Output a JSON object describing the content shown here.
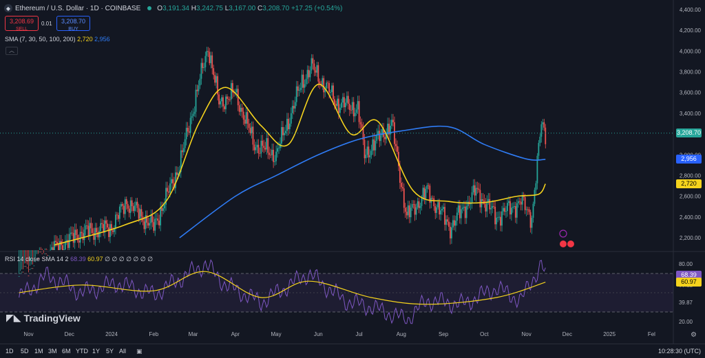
{
  "header": {
    "symbol_icon": "ethereum-icon",
    "title": "Ethereum / U.S. Dollar · 1D · COINBASE",
    "open_label": "O",
    "open": "3,191.34",
    "high_label": "H",
    "high": "3,242.75",
    "low_label": "L",
    "low": "3,167.00",
    "close_label": "C",
    "close": "3,208.70",
    "change": "+17.25 (+0.54%)"
  },
  "trade": {
    "sell_price": "3,208.69",
    "sell_label": "SELL",
    "spread": "0.01",
    "buy_price": "3,208.70",
    "buy_label": "BUY"
  },
  "sma_legend": {
    "label": "SMA (7, 30, 50, 100, 200)",
    "value_yellow": "2,720",
    "value_blue": "2,956"
  },
  "rsi_legend": {
    "label": "RSI 14 close SMA 14 2",
    "value_rsi": "68.39",
    "value_sma": "60.97",
    "blanks": "∅ ∅ ∅ ∅ ∅ ∅ ∅"
  },
  "price_axis": [
    "4,400.00",
    "4,200.00",
    "4,000.00",
    "3,800.00",
    "3,600.00",
    "3,400.00",
    "3,000.00",
    "2,800.00",
    "2,600.00",
    "2,400.00",
    "2,200.00"
  ],
  "price_tags": {
    "last": "3,208.70",
    "sma_blue": "2,956",
    "sma_yellow": "2,720"
  },
  "rsi_axis": [
    "80.00",
    "58.12",
    "39.87",
    "20.00"
  ],
  "rsi_tags": {
    "rsi": "68.39",
    "sma": "60.97"
  },
  "time_axis": [
    "Nov",
    "Dec",
    "2024",
    "Feb",
    "Mar",
    "Apr",
    "May",
    "Jun",
    "Jul",
    "Aug",
    "Sep",
    "Oct",
    "Nov",
    "Dec",
    "2025",
    "Fel"
  ],
  "bottom_bar": {
    "timeframes": [
      "1D",
      "5D",
      "1M",
      "3M",
      "6M",
      "YTD",
      "1Y",
      "5Y",
      "All"
    ],
    "clock": "10:28:30 (UTC)"
  },
  "branding": "TradingView",
  "colors": {
    "up": "#26a69a",
    "down": "#ef5350",
    "sma_yellow": "#f5d31d",
    "sma_blue": "#2f7cf6",
    "rsi_line": "#7e57c2",
    "background": "#131722"
  },
  "chart_data": [
    {
      "type": "candlestick",
      "title": "Ethereum / U.S. Dollar · 1D · COINBASE",
      "ylim": [
        2100,
        4450
      ],
      "x_range": [
        "Oct 2023",
        "Feb 2025"
      ],
      "series": [
        {
          "name": "ETHUSD close (approx.)",
          "x": [
            "2023-10-25",
            "2023-11-15",
            "2023-12-10",
            "2024-01-01",
            "2024-01-12",
            "2024-02-01",
            "2024-02-20",
            "2024-03-12",
            "2024-03-20",
            "2024-04-01",
            "2024-04-15",
            "2024-05-01",
            "2024-05-20",
            "2024-05-27",
            "2024-06-15",
            "2024-06-30",
            "2024-07-05",
            "2024-07-25",
            "2024-08-05",
            "2024-08-20",
            "2024-09-06",
            "2024-09-25",
            "2024-10-10",
            "2024-10-28",
            "2024-11-05",
            "2024-11-12",
            "2024-11-15"
          ],
          "values": [
            1800,
            2050,
            2250,
            2300,
            2550,
            2300,
            2900,
            4050,
            3500,
            3600,
            3100,
            3000,
            3700,
            3850,
            3500,
            3450,
            3000,
            3300,
            2400,
            2650,
            2300,
            2650,
            2400,
            2550,
            2400,
            3300,
            3208.7
          ]
        },
        {
          "name": "SMA",
          "x": [
            "2023-11-20",
            "2024-01-10",
            "2024-02-10",
            "2024-03-05",
            "2024-03-25",
            "2024-04-20",
            "2024-05-10",
            "2024-06-01",
            "2024-06-25",
            "2024-07-15",
            "2024-08-10",
            "2024-09-05",
            "2024-10-01",
            "2024-10-25",
            "2024-11-10",
            "2024-11-15"
          ],
          "values": [
            2130,
            2320,
            2550,
            3300,
            3650,
            3280,
            3100,
            3680,
            3200,
            3320,
            2650,
            2550,
            2540,
            2600,
            2620,
            2720
          ]
        },
        {
          "name": "SMA",
          "x": [
            "2024-02-20",
            "2024-04-01",
            "2024-05-01",
            "2024-06-01",
            "2024-07-01",
            "2024-08-01",
            "2024-09-05",
            "2024-10-01",
            "2024-11-01",
            "2024-11-15"
          ],
          "values": [
            2200,
            2600,
            2800,
            3000,
            3150,
            3230,
            3270,
            3100,
            2960,
            2956
          ]
        }
      ]
    },
    {
      "type": "line",
      "title": "RSI 14 close SMA 14 2",
      "ylim": [
        20,
        85
      ],
      "levels": [
        70,
        58.12,
        39.87,
        30
      ],
      "series": [
        {
          "name": "RSI",
          "x": [
            "2023-10-25",
            "2023-11-15",
            "2023-12-10",
            "2024-01-05",
            "2024-02-01",
            "2024-03-10",
            "2024-03-25",
            "2024-04-20",
            "2024-05-25",
            "2024-06-20",
            "2024-07-10",
            "2024-08-05",
            "2024-08-20",
            "2024-09-15",
            "2024-10-10",
            "2024-10-28",
            "2024-11-12",
            "2024-11-15"
          ],
          "values": [
            45,
            68,
            50,
            60,
            48,
            80,
            58,
            40,
            70,
            42,
            35,
            22,
            42,
            38,
            55,
            42,
            80,
            68.39
          ]
        },
        {
          "name": "SMA",
          "x": [
            "2023-10-25",
            "2023-12-10",
            "2024-02-01",
            "2024-03-10",
            "2024-04-20",
            "2024-05-25",
            "2024-07-10",
            "2024-08-20",
            "2024-10-10",
            "2024-11-15"
          ],
          "values": [
            50,
            58,
            52,
            72,
            45,
            62,
            45,
            38,
            45,
            60.97
          ]
        }
      ]
    }
  ]
}
